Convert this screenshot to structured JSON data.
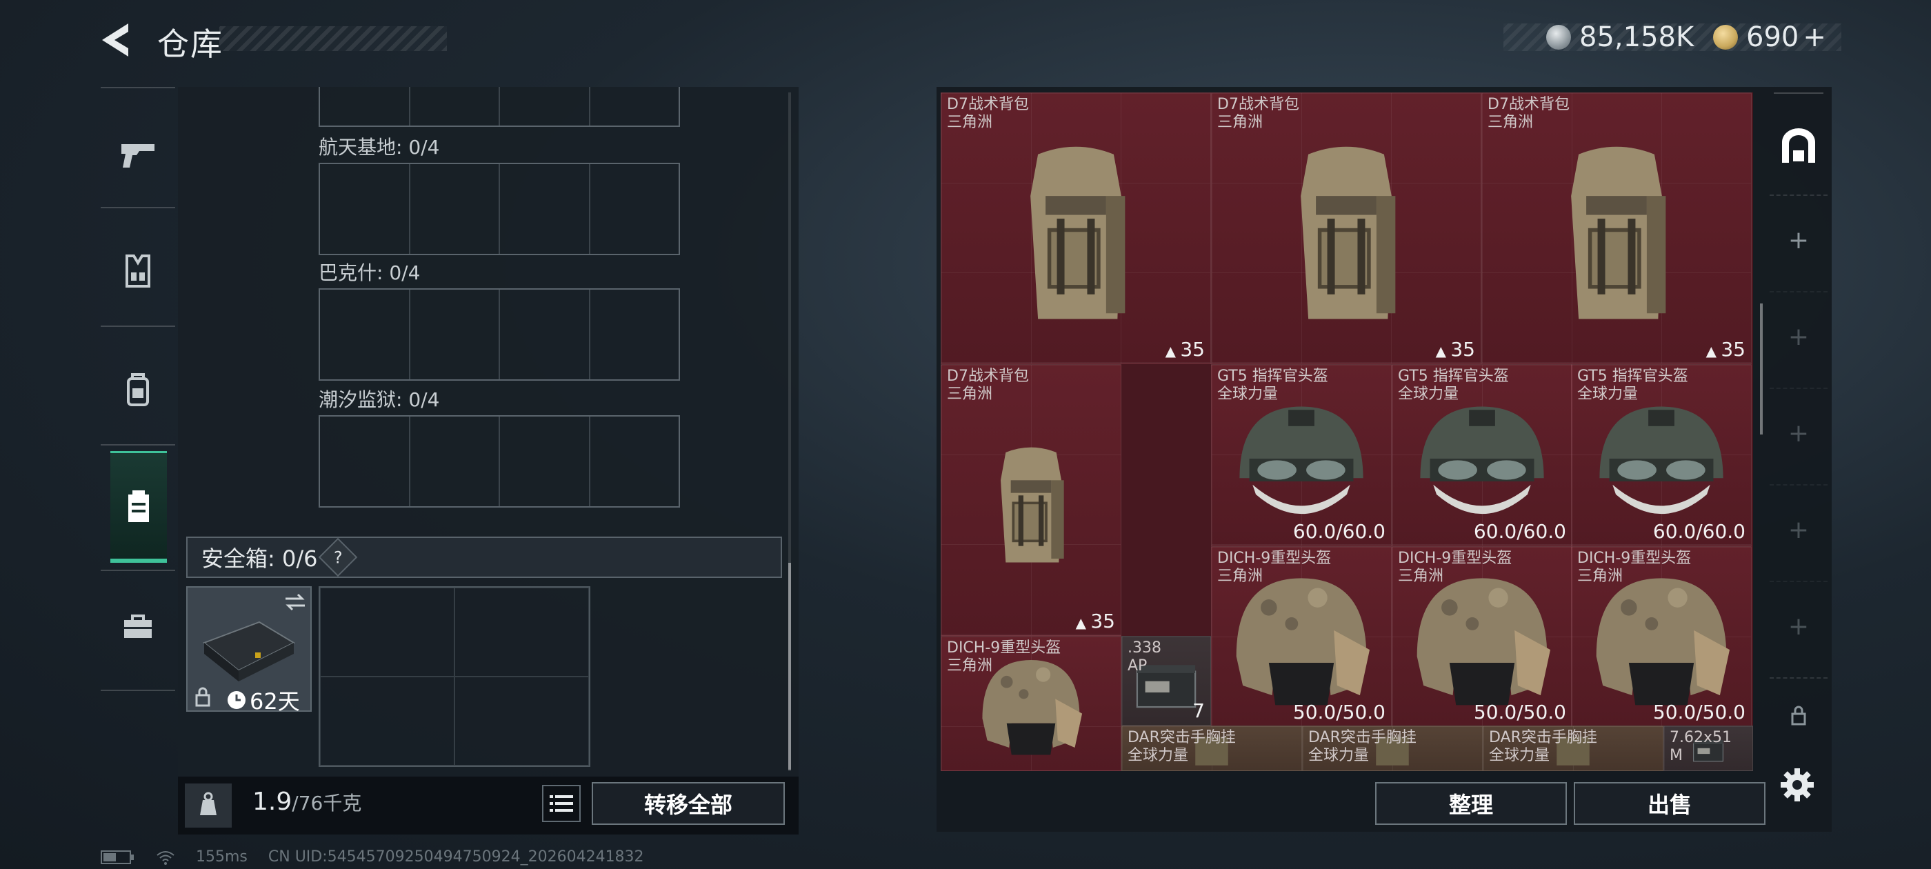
{
  "header": {
    "title": "仓库",
    "currency": [
      {
        "icon": "silver-coin-icon",
        "value": "85,158K",
        "color": "#9aa4ab"
      },
      {
        "icon": "gold-coin-icon",
        "value": "690",
        "suffix": "+",
        "color": "#c9a85c"
      }
    ]
  },
  "categories": [
    {
      "icon": "pistol-icon",
      "active": false
    },
    {
      "icon": "vest-icon",
      "active": false
    },
    {
      "icon": "backpack-icon",
      "active": false
    },
    {
      "icon": "case-icon",
      "active": true
    },
    {
      "icon": "toolbox-icon",
      "active": false
    }
  ],
  "left": {
    "regions": [
      {
        "label": "航天基地: 0/4"
      },
      {
        "label": "巴克什: 0/4"
      },
      {
        "label": "潮汐监狱: 0/4"
      }
    ],
    "safe_box": {
      "label": "安全箱: 0/6",
      "help": "?",
      "item_timer": "62天"
    },
    "weight": {
      "current": "1.9",
      "max": "/76千克"
    },
    "transfer_label": "转移全部"
  },
  "stash": {
    "items": [
      {
        "name": "D7战术背包",
        "sub": "三角洲",
        "qty": "35",
        "kind": "backpack"
      },
      {
        "name": "D7战术背包",
        "sub": "三角洲",
        "qty": "35",
        "kind": "backpack"
      },
      {
        "name": "D7战术背包",
        "sub": "三角洲",
        "qty": "35",
        "kind": "backpack"
      },
      {
        "name": "D7战术背包",
        "sub": "三角洲",
        "qty": "35",
        "kind": "backpack"
      },
      {
        "name": "GT5 指挥官头盔",
        "sub": "全球力量",
        "qty": "60.0/60.0",
        "kind": "helmet-nv"
      },
      {
        "name": "GT5 指挥官头盔",
        "sub": "全球力量",
        "qty": "60.0/60.0",
        "kind": "helmet-nv"
      },
      {
        "name": "GT5 指挥官头盔",
        "sub": "全球力量",
        "qty": "60.0/60.0",
        "kind": "helmet-nv"
      },
      {
        "name": "DICH-9重型头盔",
        "sub": "三角洲",
        "qty": "50.0/50.0",
        "kind": "helmet"
      },
      {
        "name": "DICH-9重型头盔",
        "sub": "三角洲",
        "qty": "50.0/50.0",
        "kind": "helmet"
      },
      {
        "name": "DICH-9重型头盔",
        "sub": "三角洲",
        "qty": "50.0/50.0",
        "kind": "helmet"
      },
      {
        "name": "DICH-9重型头盔",
        "sub": "三角洲",
        "qty": "",
        "kind": "helmet"
      },
      {
        "name": ".338",
        "sub": "AP",
        "qty": "7",
        "kind": "ammo"
      },
      {
        "name": "DAR突击手胸挂",
        "sub": "全球力量",
        "qty": "",
        "kind": "rig"
      },
      {
        "name": "DAR突击手胸挂",
        "sub": "全球力量",
        "qty": "",
        "kind": "rig"
      },
      {
        "name": "DAR突击手胸挂",
        "sub": "全球力量",
        "qty": "",
        "kind": "rig"
      },
      {
        "name": "7.62x51",
        "sub": "M",
        "qty": "",
        "kind": "ammo"
      }
    ],
    "sort_label": "整理",
    "sell_label": "出售"
  },
  "status": {
    "ping": "155ms",
    "uid": "CN UID:54545709250494750924_202604241832"
  }
}
